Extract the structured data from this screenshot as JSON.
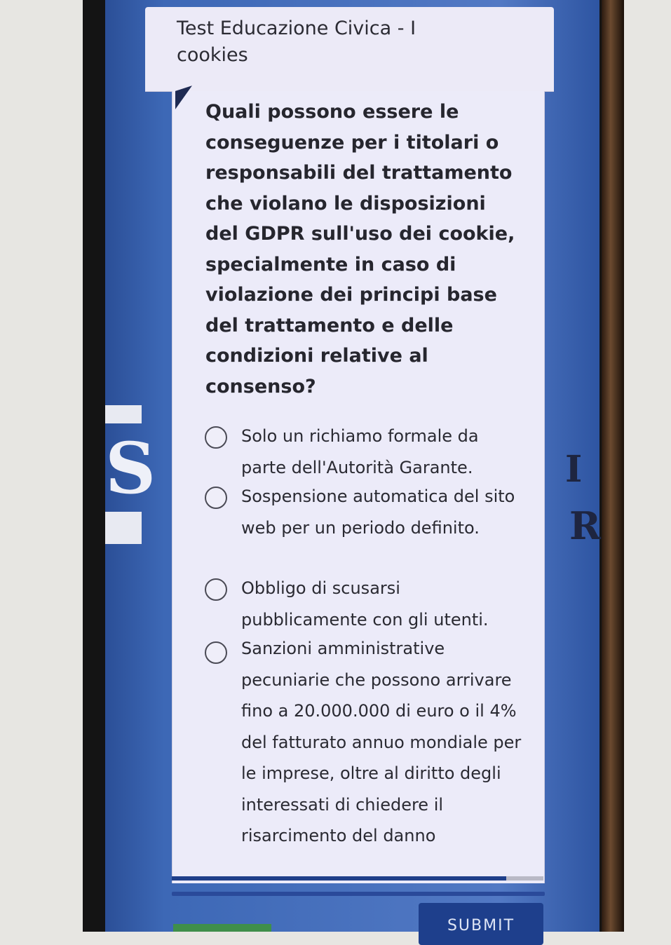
{
  "header": {
    "title": "Test Educazione Civica - I cookies"
  },
  "question": {
    "text": "Quali possono essere le conseguenze per i titolari o responsabili del trattamento che violano le disposizioni del GDPR sull'uso dei cookie, specialmente in caso di violazione dei principi base del trattamento e delle condizioni relative al consenso?"
  },
  "options": [
    {
      "label": "Solo un richiamo formale da parte dell'Autorità Garante."
    },
    {
      "label": "Sospensione automatica del sito web per un periodo definito."
    },
    {
      "label": "Obbligo di scusarsi pubblicamente con gli utenti."
    },
    {
      "label": "Sanzioni amministrative pecuniarie che possono arrivare fino a 20.000.000 di euro o il 4% del fatturato annuo mondiale per le imprese, oltre al diritto degli interessati di chiedere il risarcimento del danno"
    }
  ],
  "background": {
    "letter_1": "S",
    "letter_2": "I",
    "letter_3": "R"
  },
  "progress": {
    "fraction": 0.9
  },
  "submit": {
    "label": "SUBMIT"
  },
  "colors": {
    "accent": "#1e3f8c",
    "page_bg": "#3d68b6",
    "card": "#ecebf9"
  }
}
